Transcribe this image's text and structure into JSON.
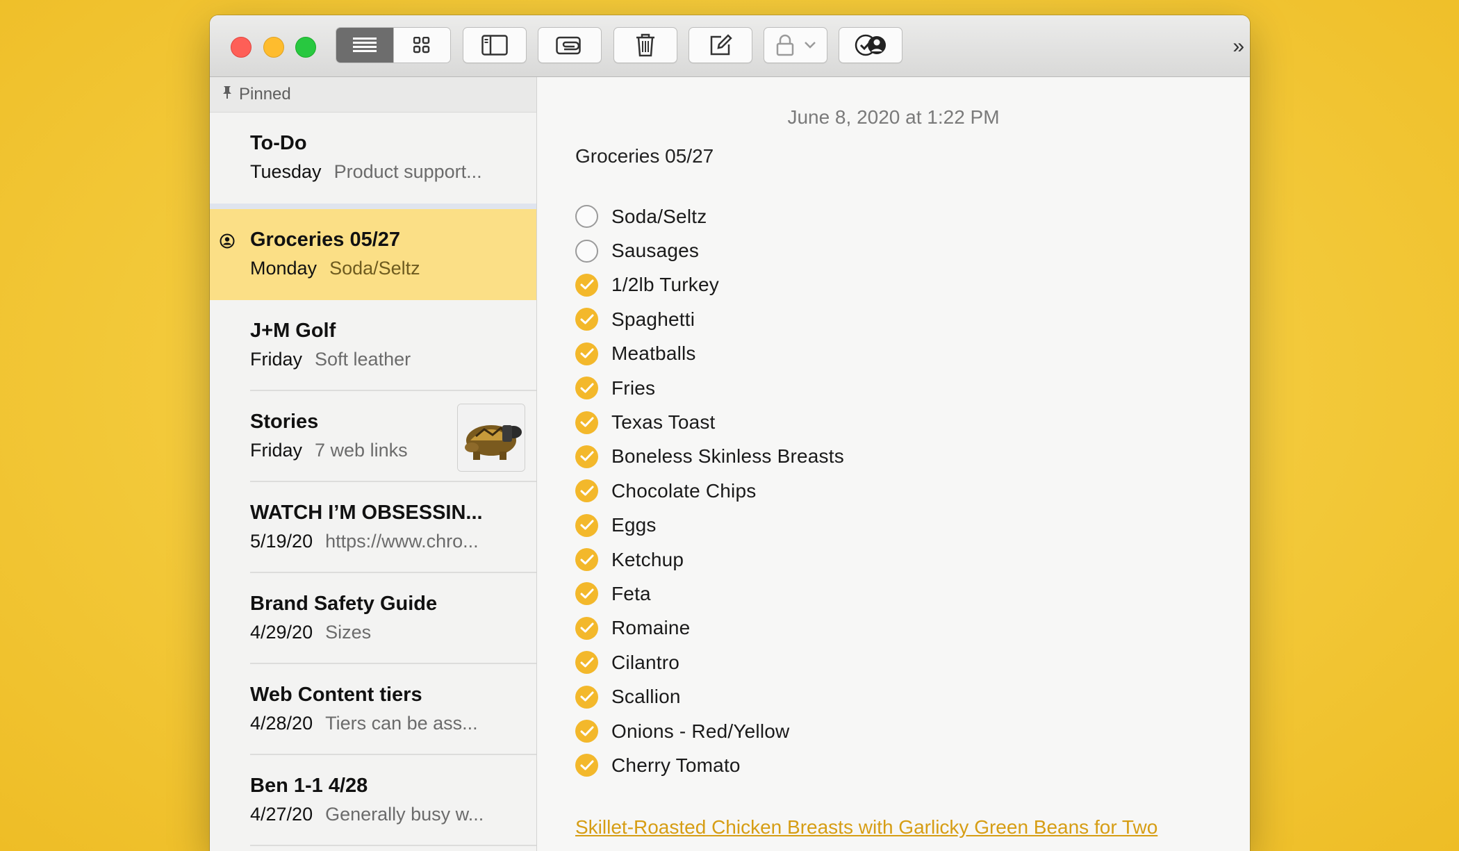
{
  "toolbar": {
    "icons": [
      "list-view-icon",
      "gallery-view-icon",
      "sidebar-icon",
      "attachments-icon",
      "trash-icon",
      "compose-icon",
      "lock-icon",
      "collaborate-icon"
    ],
    "more": "»"
  },
  "sidebar": {
    "pinned_label": "Pinned",
    "notes": [
      {
        "title": "To-Do",
        "date": "Tuesday",
        "preview": "Product support..."
      },
      {
        "title": "Groceries 05/27",
        "date": "Monday",
        "preview": "Soda/Seltz"
      },
      {
        "title": "J+M Golf",
        "date": "Friday",
        "preview": "Soft leather"
      },
      {
        "title": "Stories",
        "date": "Friday",
        "preview": "7 web links"
      },
      {
        "title": "WATCH I’M OBSESSIN...",
        "date": "5/19/20",
        "preview": "https://www.chro..."
      },
      {
        "title": "Brand Safety Guide",
        "date": "4/29/20",
        "preview": "Sizes"
      },
      {
        "title": "Web Content tiers",
        "date": "4/28/20",
        "preview": "Tiers can be ass..."
      },
      {
        "title": "Ben 1-1 4/28",
        "date": "4/27/20",
        "preview": "Generally busy w..."
      }
    ]
  },
  "editor": {
    "timestamp": "June 8, 2020 at 1:22 PM",
    "title": "Groceries 05/27",
    "items": [
      {
        "text": "Soda/Seltz",
        "checked": false
      },
      {
        "text": "Sausages",
        "checked": false
      },
      {
        "text": "1/2lb Turkey",
        "checked": true
      },
      {
        "text": "Spaghetti",
        "checked": true
      },
      {
        "text": "Meatballs",
        "checked": true
      },
      {
        "text": "Fries",
        "checked": true
      },
      {
        "text": "Texas Toast",
        "checked": true
      },
      {
        "text": "Boneless Skinless Breasts",
        "checked": true
      },
      {
        "text": "Chocolate Chips",
        "checked": true
      },
      {
        "text": "Eggs",
        "checked": true
      },
      {
        "text": "Ketchup",
        "checked": true
      },
      {
        "text": "Feta",
        "checked": true
      },
      {
        "text": "Romaine",
        "checked": true
      },
      {
        "text": "Cilantro",
        "checked": true
      },
      {
        "text": "Scallion",
        "checked": true
      },
      {
        "text": "Onions - Red/Yellow",
        "checked": true
      },
      {
        "text": "Cherry Tomato",
        "checked": true
      }
    ],
    "link_text": "Skillet-Roasted Chicken Breasts with Garlicky Green Beans for Two"
  },
  "colors": {
    "accent": "#f3b82b",
    "selected_note": "#fbdf86",
    "link": "#d69d14"
  }
}
